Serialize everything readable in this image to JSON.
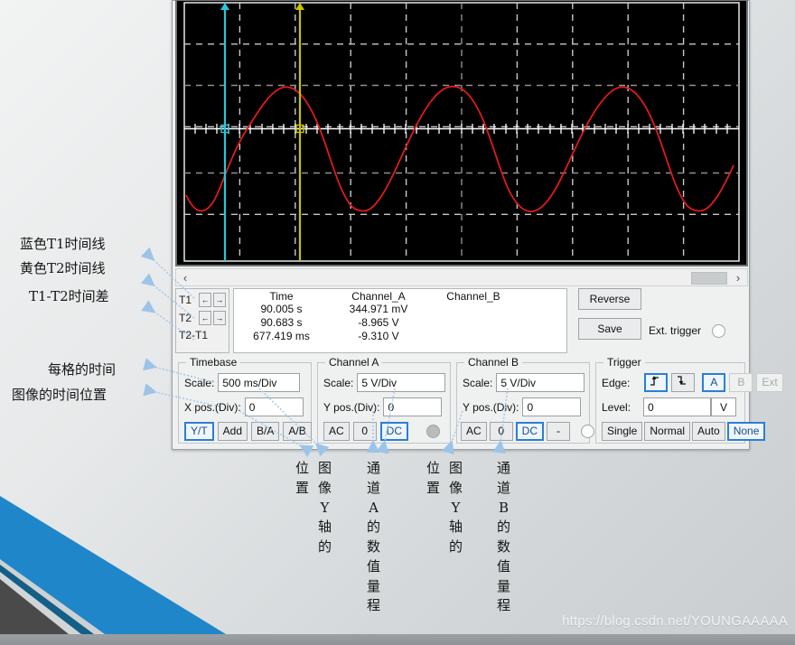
{
  "scope": {
    "screen": {
      "grid_cols": 10,
      "grid_rows": 8,
      "bg_color": "#000000",
      "grid_color": "#c8c8c8",
      "trace_color": "#e01b1b",
      "t1_cursor_color": "#28c8d8",
      "t2_cursor_color": "#c8c400"
    },
    "scrollbar": {
      "left_arrow": "‹",
      "right_arrow": "›"
    },
    "cursors": {
      "t1_label": "T1",
      "t2_label": "T2",
      "diff_label": "T2-T1",
      "left_arrow": "←",
      "right_arrow": "→"
    },
    "readout": {
      "headers": [
        "Time",
        "Channel_A",
        "Channel_B"
      ],
      "rows": [
        [
          "90.005 s",
          "344.971 mV",
          ""
        ],
        [
          "90.683 s",
          "-8.965 V",
          ""
        ],
        [
          "677.419 ms",
          "-9.310 V",
          ""
        ]
      ]
    },
    "side": {
      "reverse_label": "Reverse",
      "save_label": "Save",
      "ext_trigger_label": "Ext. trigger"
    },
    "timebase": {
      "title": "Timebase",
      "scale_label": "Scale:",
      "scale_value": "500 ms/Div",
      "xpos_label": "X pos.(Div):",
      "xpos_value": "0",
      "modes": [
        "Y/T",
        "Add",
        "B/A",
        "A/B"
      ],
      "selected_mode": "Y/T"
    },
    "channel_a": {
      "title": "Channel A",
      "scale_label": "Scale:",
      "scale_value": "5  V/Div",
      "ypos_label": "Y pos.(Div):",
      "ypos_value": "0",
      "coupling": [
        "AC",
        "0",
        "DC"
      ],
      "selected_coupling": "DC",
      "led_on": true
    },
    "channel_b": {
      "title": "Channel B",
      "scale_label": "Scale:",
      "scale_value": "5  V/Div",
      "ypos_label": "Y pos.(Div):",
      "ypos_value": "0",
      "coupling": [
        "AC",
        "0",
        "DC",
        "-"
      ],
      "selected_coupling": "DC",
      "led_on": false
    },
    "trigger": {
      "title": "Trigger",
      "edge_label": "Edge:",
      "edge_rising": "⤴",
      "edge_falling": "⤵",
      "sources": [
        "A",
        "B",
        "Ext"
      ],
      "selected_source": "A",
      "disabled_sources": [
        "B",
        "Ext"
      ],
      "level_label": "Level:",
      "level_value": "0",
      "level_unit": "V",
      "modes": [
        "Single",
        "Normal",
        "Auto",
        "None"
      ],
      "selected_mode": "None"
    }
  },
  "annotations": {
    "left": [
      "蓝色T1时间线",
      "黄色T2时间线",
      "T1-T2时间差",
      "每格的时间",
      "图像的时间位置"
    ],
    "vertical": [
      "位置",
      "图像Y轴的",
      "通道A的数值量程",
      "位置",
      "图像Y轴的",
      "通道B的数值量程"
    ]
  },
  "watermark": {
    "text": "https://blog.csdn.net/YOUNGAAAAA"
  },
  "theme": {
    "accent_blue": "#1f87c9",
    "deep_blue": "#135f86",
    "dark_gray": "#4a4a4a",
    "selection_blue": "#2a7fd4"
  }
}
